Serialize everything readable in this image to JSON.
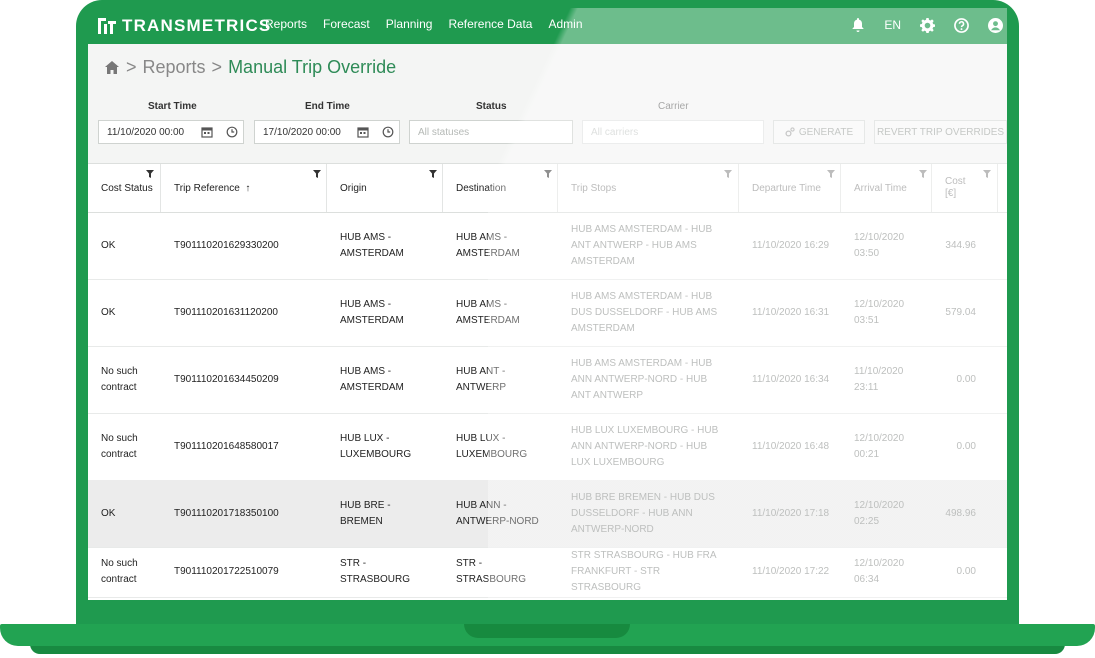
{
  "app": {
    "logo_text": "TRANSMETRICS",
    "nav": [
      "Reports",
      "Forecast",
      "Planning",
      "Reference Data",
      "Admin"
    ],
    "language": "EN",
    "icons": [
      "bell-icon",
      "gear-icon",
      "help-icon",
      "user-icon"
    ]
  },
  "breadcrumb": {
    "root": "Reports",
    "separator": ">",
    "current": "Manual Trip Override"
  },
  "filters": {
    "start_time_label": "Start Time",
    "start_time_value": "11/10/2020 00:00",
    "end_time_label": "End Time",
    "end_time_value": "17/10/2020 00:00",
    "status_label": "Status",
    "status_placeholder": "All statuses",
    "carrier_label": "Carrier",
    "carrier_placeholder": "All carriers",
    "generate_label": "GENERATE",
    "revert_label": "REVERT TRIP OVERRIDES"
  },
  "table": {
    "columns": [
      "Cost Status",
      "Trip Reference",
      "Origin",
      "Destination",
      "Trip Stops",
      "Departure Time",
      "Arrival Time",
      "Cost [€]"
    ],
    "sort_indicator": "↑",
    "rows": [
      {
        "cost_status": "OK",
        "trip_reference": "T901110201629330200",
        "origin": "HUB AMS - AMSTERDAM",
        "destination": "HUB AMS - AMSTERDAM",
        "trip_stops": "HUB AMS AMSTERDAM - HUB ANT ANTWERP - HUB AMS AMSTERDAM",
        "departure": "11/10/2020 16:29",
        "arrival": "12/10/2020 03:50",
        "cost": "344.96"
      },
      {
        "cost_status": "OK",
        "trip_reference": "T901110201631120200",
        "origin": "HUB AMS - AMSTERDAM",
        "destination": "HUB AMS - AMSTERDAM",
        "trip_stops": "HUB AMS AMSTERDAM - HUB DUS DUSSELDORF - HUB AMS AMSTERDAM",
        "departure": "11/10/2020 16:31",
        "arrival": "12/10/2020 03:51",
        "cost": "579.04"
      },
      {
        "cost_status": "No such contract",
        "trip_reference": "T901110201634450209",
        "origin": "HUB AMS - AMSTERDAM",
        "destination": "HUB ANT - ANTWERP",
        "trip_stops": "HUB AMS AMSTERDAM - HUB ANN ANTWERP-NORD - HUB ANT ANTWERP",
        "departure": "11/10/2020 16:34",
        "arrival": "11/10/2020 23:11",
        "cost": "0.00"
      },
      {
        "cost_status": "No such contract",
        "trip_reference": "T901110201648580017",
        "origin": "HUB LUX - LUXEMBOURG",
        "destination": "HUB LUX - LUXEMBOURG",
        "trip_stops": "HUB LUX LUXEMBOURG - HUB ANN ANTWERP-NORD - HUB LUX LUXEMBOURG",
        "departure": "11/10/2020 16:48",
        "arrival": "12/10/2020 00:21",
        "cost": "0.00"
      },
      {
        "cost_status": "OK",
        "trip_reference": "T901110201718350100",
        "origin": "HUB BRE - BREMEN",
        "destination": "HUB ANN - ANTWERP-NORD",
        "trip_stops": "HUB BRE BREMEN - HUB DUS DUSSELDORF - HUB ANN ANTWERP-NORD",
        "departure": "11/10/2020 17:18",
        "arrival": "12/10/2020 02:25",
        "cost": "498.96"
      },
      {
        "cost_status": "No such contract",
        "trip_reference": "T901110201722510079",
        "origin": "STR - STRASBOURG",
        "destination": "STR - STRASBOURG",
        "trip_stops": "STR STRASBOURG - HUB FRA FRANKFURT - STR STRASBOURG",
        "departure": "11/10/2020 17:22",
        "arrival": "12/10/2020 06:34",
        "cost": "0.00"
      }
    ]
  },
  "colors": {
    "brand_green": "#1f9a4f",
    "breadcrumb_current": "#2e8b57"
  }
}
